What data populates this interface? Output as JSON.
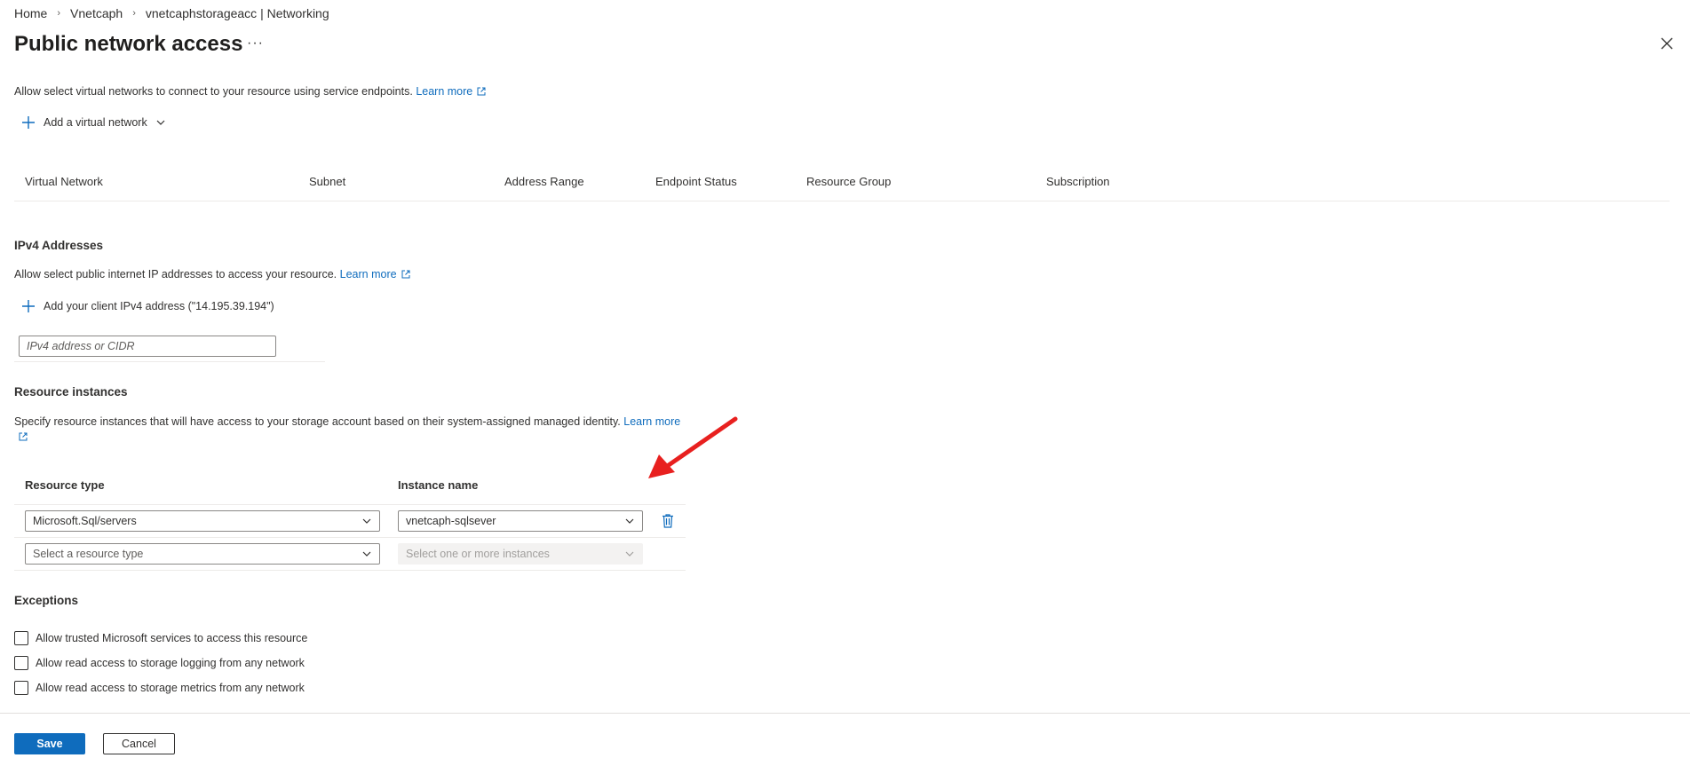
{
  "breadcrumb": [
    "Home",
    "Vnetcaph",
    "vnetcaphstorageacc | Networking"
  ],
  "page_title": "Public network access",
  "more_label": "···",
  "vnet": {
    "description": "Allow select virtual networks to connect to your resource using service endpoints.",
    "learn_more": "Learn more",
    "add_label": "Add a virtual network",
    "columns": [
      "Virtual Network",
      "Subnet",
      "Address Range",
      "Endpoint Status",
      "Resource Group",
      "Subscription"
    ]
  },
  "ipv4": {
    "title": "IPv4 Addresses",
    "description": "Allow select public internet IP addresses to access your resource.",
    "learn_more": "Learn more",
    "add_label": "Add your client IPv4 address (\"14.195.39.194\")",
    "input_placeholder": "IPv4 address or CIDR"
  },
  "resource_instances": {
    "title": "Resource instances",
    "description": "Specify resource instances that will have access to your storage account based on their system-assigned managed identity.",
    "learn_more_1": "Learn",
    "learn_more_2": "more",
    "col_resource_type": "Resource type",
    "col_instance_name": "Instance name",
    "rows": [
      {
        "resource_type": "Microsoft.Sql/servers",
        "instance": "vnetcaph-sqlsever"
      },
      {
        "resource_type": "Select a resource type",
        "instance": "Select one or more instances"
      }
    ]
  },
  "exceptions": {
    "title": "Exceptions",
    "items": [
      "Allow trusted Microsoft services to access this resource",
      "Allow read access to storage logging from any network",
      "Allow read access to storage metrics from any network"
    ]
  },
  "footer": {
    "save": "Save",
    "cancel": "Cancel"
  },
  "colors": {
    "accent": "#0f6cbd",
    "annotation_arrow": "#e8201f"
  }
}
